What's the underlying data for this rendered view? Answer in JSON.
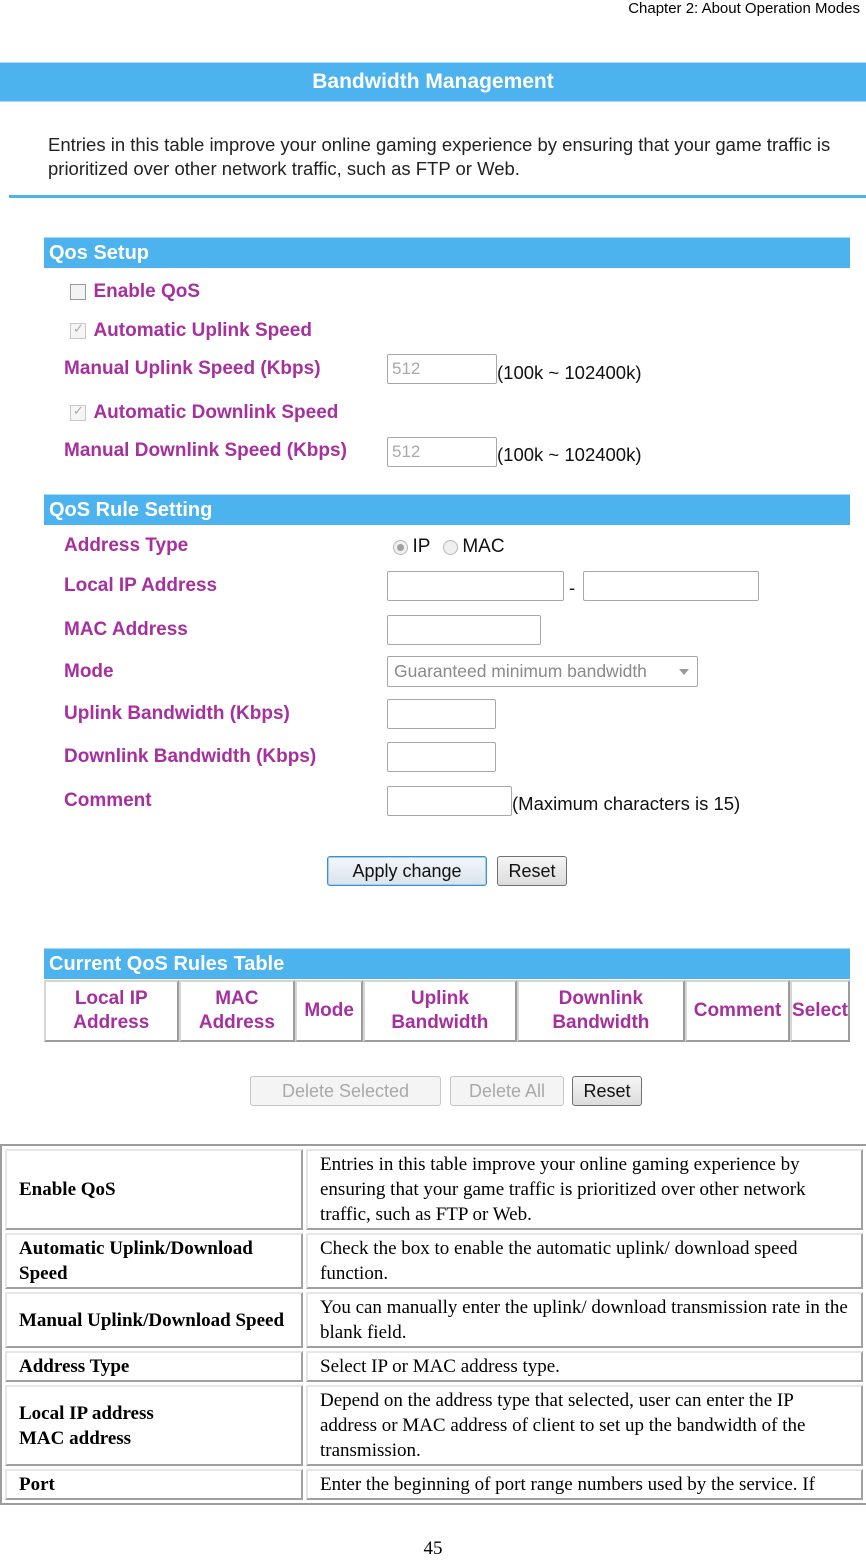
{
  "header": {
    "chapter": "Chapter 2: About Operation Modes"
  },
  "banner": {
    "title": "Bandwidth Management"
  },
  "intro": "Entries in this table improve your online gaming experience by ensuring that your game traffic is prioritized over other network traffic, such as FTP or Web.",
  "qos_setup": {
    "title": "Qos Setup",
    "enable_qos": {
      "label": "Enable QoS",
      "checked": false
    },
    "auto_uplink": {
      "label": "Automatic Uplink Speed",
      "checked": true
    },
    "manual_uplink": {
      "label": "Manual Uplink Speed (Kbps)",
      "value": "512",
      "hint": "(100k ~ 102400k)"
    },
    "auto_downlink": {
      "label": "Automatic Downlink Speed",
      "checked": true
    },
    "manual_downlink": {
      "label": "Manual Downlink Speed (Kbps)",
      "value": "512",
      "hint": "(100k ~ 102400k)"
    }
  },
  "qos_rule": {
    "title": "QoS Rule Setting",
    "address_type": {
      "label": "Address Type",
      "options": [
        "IP",
        "MAC"
      ],
      "selected": "IP"
    },
    "local_ip": {
      "label": "Local IP Address",
      "separator": "-",
      "start": "",
      "end": ""
    },
    "mac": {
      "label": "MAC Address",
      "value": ""
    },
    "mode": {
      "label": "Mode",
      "selected": "Guaranteed minimum bandwidth"
    },
    "uplink_bw": {
      "label": "Uplink Bandwidth (Kbps)",
      "value": ""
    },
    "downlink_bw": {
      "label": "Downlink Bandwidth (Kbps)",
      "value": ""
    },
    "comment": {
      "label": "Comment",
      "value": "",
      "hint": "(Maximum characters is 15)"
    },
    "apply_label": "Apply change",
    "reset_label": "Reset"
  },
  "rules_table": {
    "title": "Current QoS Rules Table",
    "columns": [
      [
        "Local IP",
        "Address"
      ],
      [
        "MAC",
        "Address"
      ],
      [
        "Mode"
      ],
      [
        "Uplink",
        "Bandwidth"
      ],
      [
        "Downlink",
        "Bandwidth"
      ],
      [
        "Comment"
      ],
      [
        "Select"
      ]
    ],
    "delete_selected_label": "Delete Selected",
    "delete_all_label": "Delete All",
    "reset_label": "Reset"
  },
  "desc_table": [
    {
      "key": [
        "Enable QoS"
      ],
      "value": "Entries in this table improve your online gaming experience by ensuring that your game traffic is prioritized over other network traffic, such as FTP or Web."
    },
    {
      "key": [
        "Automatic Uplink/Download Speed"
      ],
      "value": "Check the box to enable the automatic uplink/ download speed function."
    },
    {
      "key": [
        "Manual Uplink/Download Speed"
      ],
      "value": "You can manually enter the uplink/ download transmission rate in the blank field."
    },
    {
      "key": [
        "Address Type"
      ],
      "value": "Select IP or MAC address type."
    },
    {
      "key": [
        "Local IP address",
        "MAC address"
      ],
      "value": "Depend on the address type that selected, user can enter the IP address or MAC address of client to set up the bandwidth of the transmission."
    },
    {
      "key": [
        "Port"
      ],
      "value": "Enter the beginning of port range numbers used by the service. If"
    }
  ],
  "footer": {
    "page_number": "45"
  }
}
